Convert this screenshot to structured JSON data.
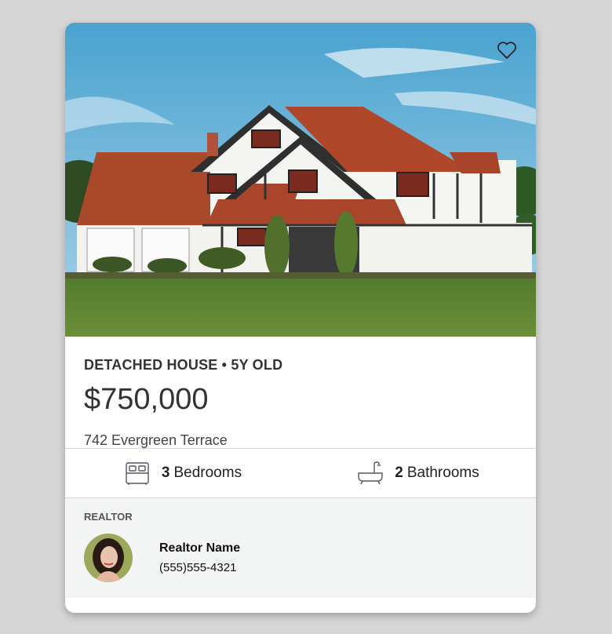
{
  "listing": {
    "type_line": "DETACHED HOUSE • 5Y OLD",
    "price": "$750,000",
    "address": "742 Evergreen Terrace",
    "photo_icon": "house-photo",
    "favorite_icon": "heart-outline-icon"
  },
  "stats": {
    "bedrooms": {
      "icon": "bed-icon",
      "count": "3",
      "label": "Bedrooms"
    },
    "bathrooms": {
      "icon": "bathtub-icon",
      "count": "2",
      "label": "Bathrooms"
    }
  },
  "realtor": {
    "heading": "REALTOR",
    "name": "Realtor Name",
    "phone": "(555)555-4321",
    "avatar_icon": "avatar-photo"
  },
  "colors": {
    "background": "#d6d6d6",
    "card": "#ffffff",
    "realtor_bg": "#f3f4f4",
    "text": "#333333"
  }
}
